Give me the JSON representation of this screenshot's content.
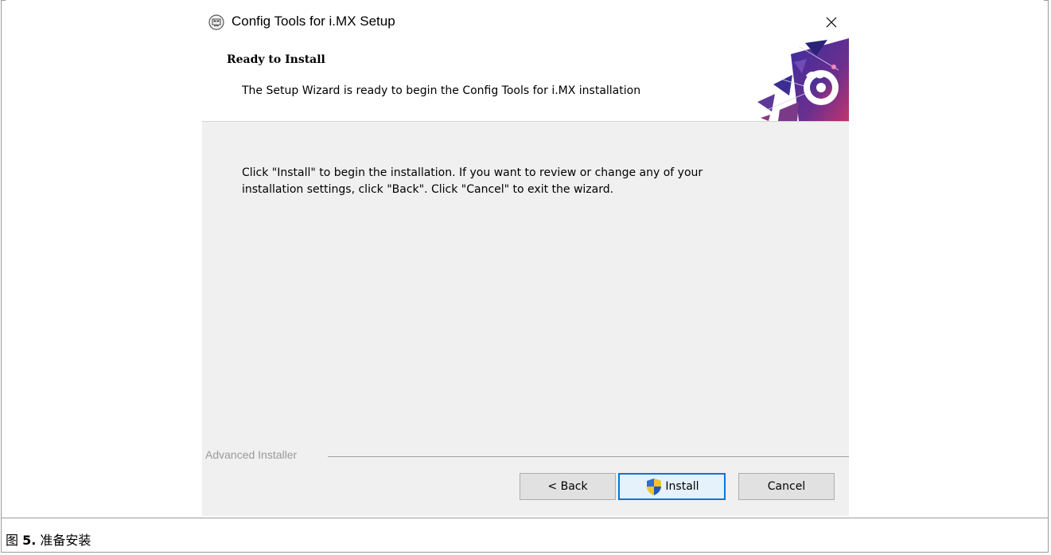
{
  "window": {
    "title": "Config Tools for i.MX Setup",
    "close_glyph": "✕"
  },
  "header": {
    "title": "Ready to Install",
    "description": "The Setup Wizard is ready to begin the Config Tools for i.MX installation"
  },
  "body": {
    "line1": "Click \"Install\" to begin the installation.  If you want to review or change any of your",
    "line2": "installation settings, click \"Back\".  Click \"Cancel\" to exit the wizard."
  },
  "footer": {
    "brand": "Advanced Installer",
    "buttons": {
      "back": "< Back",
      "install": "Install",
      "cancel": "Cancel"
    }
  },
  "caption": {
    "prefix": "图 ",
    "number": "5.",
    "text": " 准备安装"
  },
  "colors": {
    "focus_border": "#0078d7",
    "body_bg": "#f0f0f0",
    "button_bg": "#e1e1e1",
    "brand_text": "#9a9a9a"
  },
  "icons": [
    "app-icon",
    "close-icon",
    "header-art-icon",
    "uac-shield-icon"
  ]
}
